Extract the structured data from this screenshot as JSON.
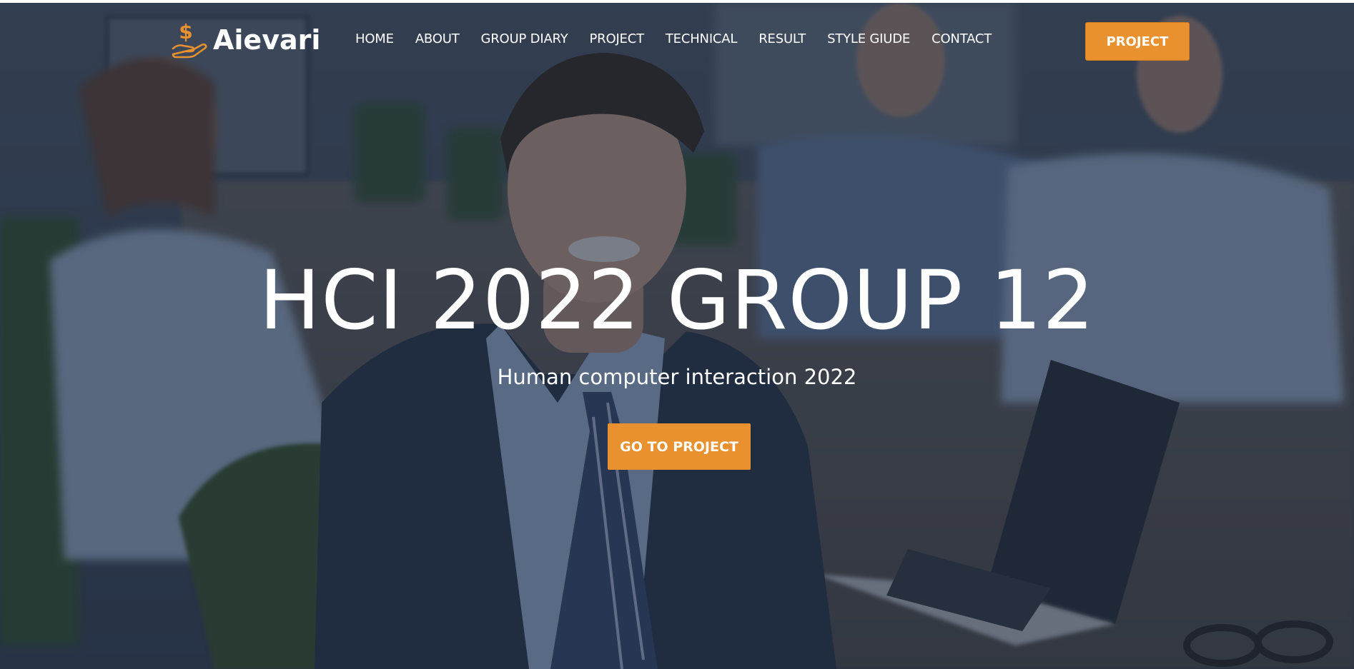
{
  "colors": {
    "accent": "#e8912e",
    "overlay": "#1c2a42",
    "text": "#ffffff"
  },
  "header": {
    "logo_text": "Aievari",
    "logo_icon": "dollar-hand-icon",
    "nav": [
      {
        "label": "HOME"
      },
      {
        "label": "ABOUT"
      },
      {
        "label": "GROUP DIARY"
      },
      {
        "label": "PROJECT"
      },
      {
        "label": "TECHNICAL"
      },
      {
        "label": "RESULT"
      },
      {
        "label": "STYLE GIUDE"
      },
      {
        "label": "CONTACT"
      }
    ],
    "cta_label": "PROJECT"
  },
  "hero": {
    "title": "HCI 2022 GROUP 12",
    "subtitle": "Human computer interaction 2022",
    "cta_label": "GO TO PROJECT"
  }
}
